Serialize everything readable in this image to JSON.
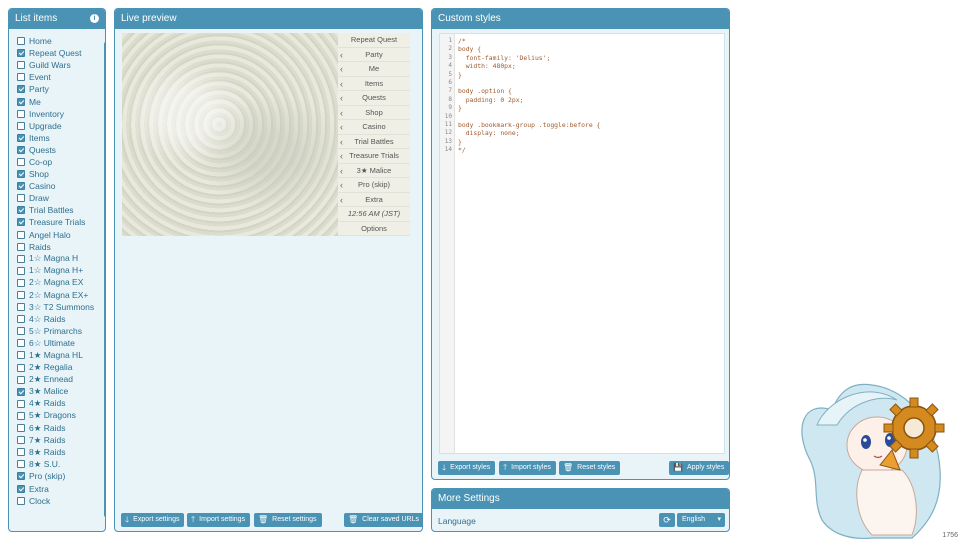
{
  "list_panel": {
    "title": "List items",
    "items": [
      {
        "label": "Home",
        "checked": false
      },
      {
        "label": "Repeat Quest",
        "checked": true
      },
      {
        "label": "Guild Wars",
        "checked": false
      },
      {
        "label": "Event",
        "checked": false
      },
      {
        "label": "Party",
        "checked": true
      },
      {
        "label": "Me",
        "checked": true
      },
      {
        "label": "Inventory",
        "checked": false
      },
      {
        "label": "Upgrade",
        "checked": false
      },
      {
        "label": "Items",
        "checked": true
      },
      {
        "label": "Quests",
        "checked": true
      },
      {
        "label": "Co-op",
        "checked": false
      },
      {
        "label": "Shop",
        "checked": true
      },
      {
        "label": "Casino",
        "checked": true
      },
      {
        "label": "Draw",
        "checked": false
      },
      {
        "label": "Trial Battles",
        "checked": true
      },
      {
        "label": "Treasure Trials",
        "checked": true
      },
      {
        "label": "Angel Halo",
        "checked": false
      },
      {
        "label": "Raids",
        "checked": false
      },
      {
        "label": "1☆ Magna H",
        "checked": false
      },
      {
        "label": "1☆ Magna H+",
        "checked": false
      },
      {
        "label": "2☆ Magna EX",
        "checked": false
      },
      {
        "label": "2☆ Magna EX+",
        "checked": false
      },
      {
        "label": "3☆ T2 Summons",
        "checked": false
      },
      {
        "label": "4☆ Raids",
        "checked": false
      },
      {
        "label": "5☆ Primarchs",
        "checked": false
      },
      {
        "label": "6☆ Ultimate",
        "checked": false
      },
      {
        "label": "1★ Magna HL",
        "checked": false
      },
      {
        "label": "2★ Regalia",
        "checked": false
      },
      {
        "label": "2★ Ennead",
        "checked": false
      },
      {
        "label": "3★ Malice",
        "checked": true
      },
      {
        "label": "4★ Raids",
        "checked": false
      },
      {
        "label": "5★ Dragons",
        "checked": false
      },
      {
        "label": "6★ Raids",
        "checked": false
      },
      {
        "label": "7★ Raids",
        "checked": false
      },
      {
        "label": "8★ Raids",
        "checked": false
      },
      {
        "label": "8★ S.U.",
        "checked": false
      },
      {
        "label": "Pro (skip)",
        "checked": true
      },
      {
        "label": "Extra",
        "checked": true
      },
      {
        "label": "Clock",
        "checked": false
      }
    ]
  },
  "preview_panel": {
    "title": "Live preview",
    "menu": [
      {
        "label": "Repeat Quest",
        "arrow": false
      },
      {
        "label": "Party",
        "arrow": true
      },
      {
        "label": "Me",
        "arrow": true
      },
      {
        "label": "Items",
        "arrow": true
      },
      {
        "label": "Quests",
        "arrow": true
      },
      {
        "label": "Shop",
        "arrow": true
      },
      {
        "label": "Casino",
        "arrow": true
      },
      {
        "label": "Trial Battles",
        "arrow": true
      },
      {
        "label": "Treasure Trials",
        "arrow": true
      },
      {
        "label": "3★ Malice",
        "arrow": true
      },
      {
        "label": "Pro (skip)",
        "arrow": true
      },
      {
        "label": "Extra",
        "arrow": true
      },
      {
        "label": "12:56 AM (JST)",
        "arrow": false
      },
      {
        "label": "Options",
        "arrow": false
      }
    ],
    "buttons": {
      "export": "Export settings",
      "import": "Import settings",
      "reset": "Reset settings",
      "clear": "Clear saved URLs"
    }
  },
  "styles_panel": {
    "title": "Custom styles",
    "line_numbers": "1\n2\n3\n4\n5\n6\n7\n8\n9\n10\n11\n12\n13\n14",
    "code": "/*\nbody {\n  font-family: 'Delius';\n  width: 480px;\n}\n\nbody .option {\n  padding: 0 2px;\n}\n\nbody .bookmark-group .toggle:before {\n  display: none;\n}\n*/",
    "buttons": {
      "export": "Export styles",
      "import": "Import styles",
      "reset": "Reset styles",
      "apply": "Apply styles"
    }
  },
  "more_panel": {
    "title": "More Settings",
    "language_label": "Language",
    "language_value": "English"
  },
  "corner_number": "1756",
  "colors": {
    "accent": "#4a93b4",
    "panel_bg": "#e8f4f8",
    "text": "#2f6f8f"
  },
  "icons": {
    "export": "download-arrow-icon",
    "import": "upload-arrow-icon",
    "reset": "trash-icon",
    "apply": "save-icon",
    "refresh": "refresh-icon"
  }
}
